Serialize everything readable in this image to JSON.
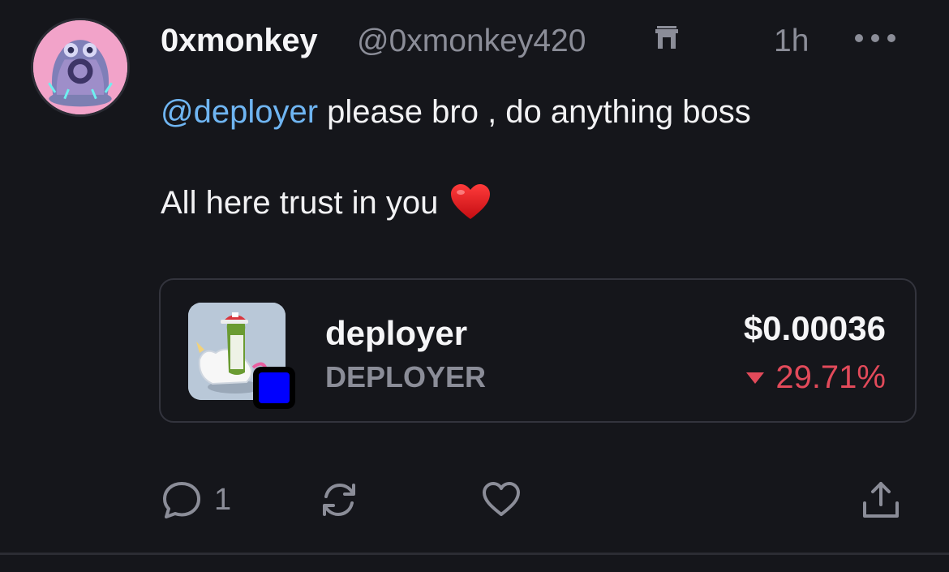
{
  "post": {
    "author": {
      "display_name": "0xmonkey",
      "handle": "@0xmonkey420",
      "badge_icon": "gate-icon",
      "avatar_icon": "monster-avatar"
    },
    "time": "1h",
    "more_icon": "more-horizontal-icon",
    "body": {
      "mention": "@deployer",
      "text_after_mention": " please bro , do anything boss",
      "line2": "All here trust in you",
      "emoji": "red-heart"
    },
    "token_card": {
      "name": "deployer",
      "symbol": "DEPLOYER",
      "price": "$0.00036",
      "change": "29.71%",
      "change_direction": "down",
      "change_color": "#e24a5a",
      "chain_badge_color": "#0000ff"
    },
    "actions": {
      "reply_count": "1",
      "reply_icon": "comment-icon",
      "repost_icon": "repost-icon",
      "like_icon": "heart-outline-icon",
      "share_icon": "share-icon"
    }
  },
  "colors": {
    "background": "#15161b",
    "mention": "#6fb5f2",
    "muted": "#8b8d98"
  }
}
